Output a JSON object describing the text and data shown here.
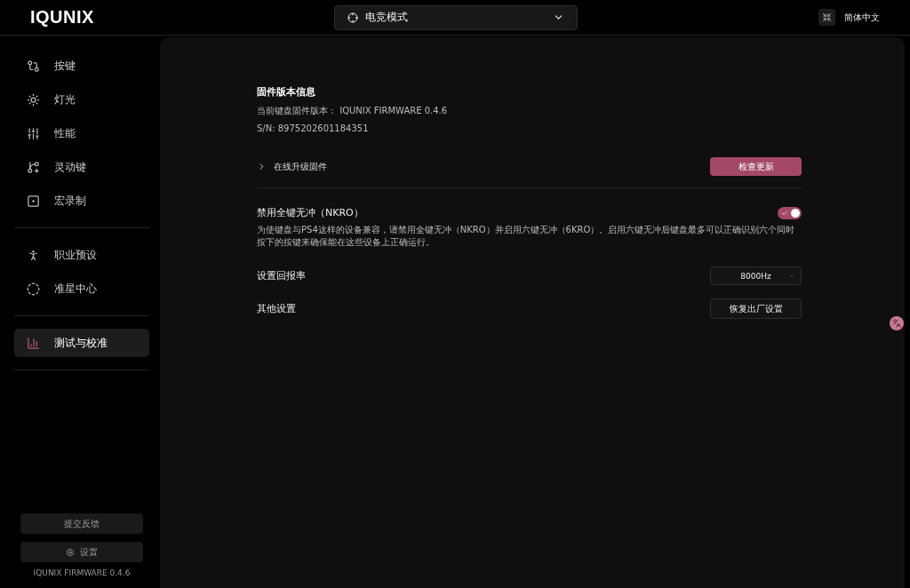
{
  "header": {
    "logo": "IQUNIX",
    "mode_select": {
      "value": "电竞模式"
    },
    "language": "简体中文"
  },
  "sidebar": {
    "groups": [
      [
        {
          "label": "按键",
          "selected": false
        },
        {
          "label": "灯光",
          "selected": false
        },
        {
          "label": "性能",
          "selected": false
        },
        {
          "label": "灵动键",
          "selected": false
        },
        {
          "label": "宏录制",
          "selected": false
        }
      ],
      [
        {
          "label": "职业预设",
          "selected": false
        },
        {
          "label": "准星中心",
          "selected": false
        }
      ],
      [
        {
          "label": "测试与校准",
          "selected": true
        }
      ]
    ],
    "feedback_button": "提交反馈",
    "settings_button": "设置",
    "firmware": "IQUNIX FIRMWARE 0.4.6"
  },
  "firmware_info": {
    "title": "固件版本信息",
    "current_version": "当前键盘固件版本： IQUNIX FIRMWARE 0.4.6",
    "serial": "S/N: 8975202601184351",
    "online_upgrade": {
      "label": "在线升级固件",
      "expanded": false
    },
    "check_update_button": "检查更新"
  },
  "nkro": {
    "label": "禁用全键无冲（NKRO）",
    "on": true,
    "description": "为使键盘与PS4这样的设备兼容，请禁用全键无冲（NKRO）并启用六键无冲（6KRO）。启用六键无冲后键盘最多可以正确识别六个同时按下的按键来确保能在这些设备上正确运行。"
  },
  "polling_rate": {
    "label": "设置回报率",
    "value": "8000Hz"
  },
  "other": {
    "label": "其他设置",
    "reset_button": "恢复出厂设置"
  }
}
